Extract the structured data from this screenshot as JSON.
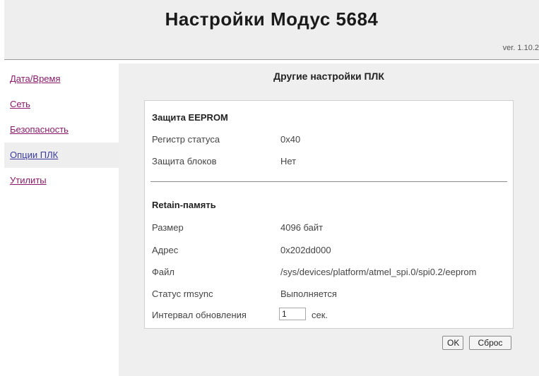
{
  "header": {
    "title": "Настройки Модус 5684",
    "version": "ver. 1.10.2"
  },
  "sidebar": {
    "items": [
      {
        "label": "Дата/Время",
        "active": false
      },
      {
        "label": "Сеть",
        "active": false
      },
      {
        "label": "Безопасность",
        "active": false
      },
      {
        "label": "Опции ПЛК",
        "active": true
      },
      {
        "label": "Утилиты",
        "active": false
      }
    ]
  },
  "main": {
    "title": "Другие настройки ПЛК",
    "eeprom": {
      "section_title": "Защита EEPROM",
      "status_register_label": "Регистр статуса",
      "status_register_value": "0x40",
      "block_protection_label": "Защита блоков",
      "block_protection_value": "Нет"
    },
    "retain": {
      "section_title": "Retain-память",
      "size_label": "Размер",
      "size_value": "4096 байт",
      "address_label": "Адрес",
      "address_value": "0x202dd000",
      "file_label": "Файл",
      "file_value": "/sys/devices/platform/atmel_spi.0/spi0.2/eeprom",
      "rmsync_label": "Статус rmsync",
      "rmsync_value": "Выполняется",
      "interval_label": "Интервал обновления",
      "interval_value": "1",
      "interval_unit": "сек."
    },
    "buttons": {
      "ok_label": "OK",
      "reset_label": "Сброс"
    }
  },
  "colors": {
    "link": "#8b1a6b",
    "active_link": "#3a3aa0",
    "panel_bg": "#efefef"
  }
}
